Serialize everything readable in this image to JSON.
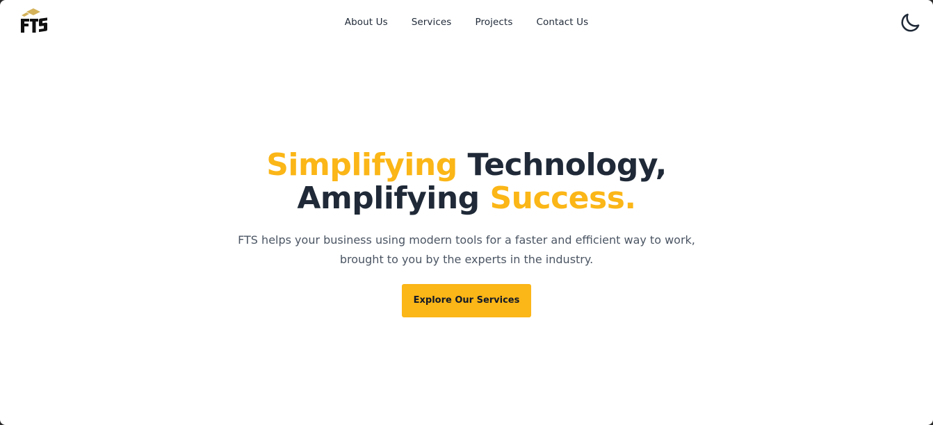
{
  "brand": {
    "logo_text": "FTS",
    "logo_color_accent": "#d4b25a",
    "logo_color_dark": "#111111"
  },
  "nav": {
    "items": [
      {
        "label": "About Us"
      },
      {
        "label": "Services"
      },
      {
        "label": "Projects"
      },
      {
        "label": "Contact Us"
      }
    ]
  },
  "theme_toggle": {
    "icon": "moon-icon"
  },
  "hero": {
    "title_line1_highlight": "Simplifying",
    "title_line1_rest": " Technology,",
    "title_line2_start": "Amplifying ",
    "title_line2_highlight": "Success.",
    "subtitle_line1": "FTS helps your business using modern tools for a faster and efficient way to work,",
    "subtitle_line2": "brought to you by the experts in the industry.",
    "cta_label": "Explore Our Services"
  },
  "colors": {
    "accent": "#fbb617",
    "heading": "#1f2937",
    "body_text": "#4b5563",
    "background": "#ffffff"
  }
}
